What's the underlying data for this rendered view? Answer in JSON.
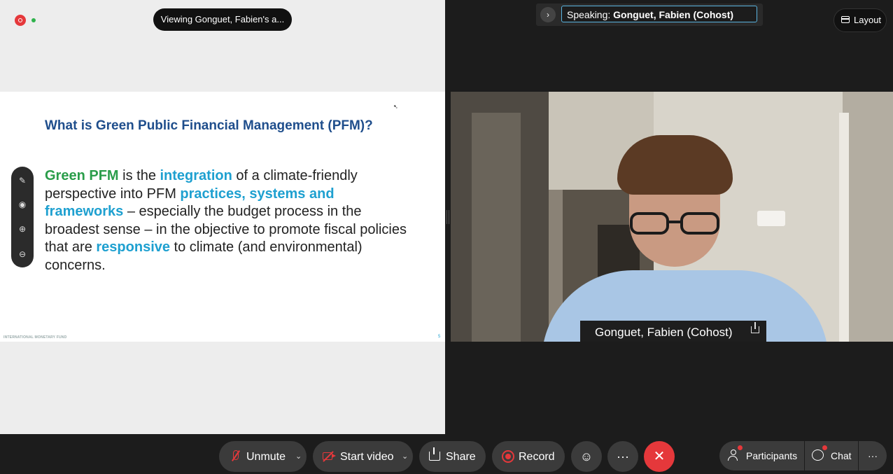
{
  "share_view": {
    "viewing_text": "Viewing Gonguet, Fabien's a...",
    "slide": {
      "title": "What is Green Public Financial Management (PFM)?",
      "body": {
        "t1": "Green PFM",
        "t2": " is the ",
        "t3": "integration",
        "t4": " of a climate-friendly perspective into PFM ",
        "t5": "practices, systems and frameworks",
        "t6": " – especially the budget process in the broadest sense – in the objective to promote fiscal policies that are ",
        "t7": "responsive",
        "t8": " to climate (and environmental) concerns."
      },
      "footer": "INTERNATIONAL MONETARY FUND",
      "page_number": "5"
    },
    "annotation_tools": [
      "pen-icon",
      "pointer-icon",
      "zoom-in-icon",
      "zoom-out-icon"
    ]
  },
  "speaking": {
    "label": "Speaking:",
    "name": "Gonguet, Fabien (Cohost)"
  },
  "layout_label": "Layout",
  "video": {
    "name_tag": "Gonguet, Fabien (Cohost)"
  },
  "toolbar": {
    "unmute": "Unmute",
    "start_video": "Start video",
    "share": "Share",
    "record": "Record",
    "more": "···",
    "end": "✕",
    "participants": "Participants",
    "chat": "Chat",
    "more_right": "···"
  },
  "colors": {
    "accent_red": "#e5383b",
    "slide_title_blue": "#1f4e8c",
    "highlight_green": "#2a9d4a",
    "highlight_blue": "#1ea0d0",
    "speaking_border": "#5ab4e0"
  }
}
